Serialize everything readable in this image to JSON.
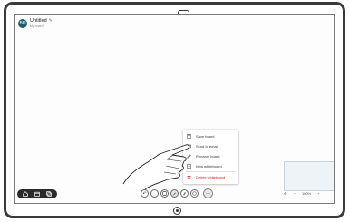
{
  "board": {
    "title": "Untitled",
    "subtitle": "My board",
    "avatar_initials": "BD"
  },
  "menu": {
    "items": [
      {
        "label": "Save board",
        "icon": "save-icon"
      },
      {
        "label": "Send to email",
        "icon": "mail-icon"
      },
      {
        "label": "Rename board",
        "icon": "pencil-icon"
      },
      {
        "label": "New whiteboard",
        "icon": "new-board-icon"
      },
      {
        "label": "Delete whiteboard",
        "icon": "trash-icon",
        "color": "#d4232a"
      }
    ]
  },
  "toolbar": {
    "left_icons": [
      "home-icon",
      "pages-icon",
      "copy-icon"
    ],
    "center_tools": [
      "undo-icon",
      "eraser-icon",
      "shapes-icon",
      "pen-icon",
      "marker-icon",
      "color-icon",
      "menu-icon"
    ],
    "zoom_out": "−",
    "zoom_level": "100%",
    "zoom_in": "+"
  },
  "colors": {
    "accent": "#1d5d72",
    "danger": "#d4232a",
    "toolbar_dark": "#2b2b2b"
  }
}
